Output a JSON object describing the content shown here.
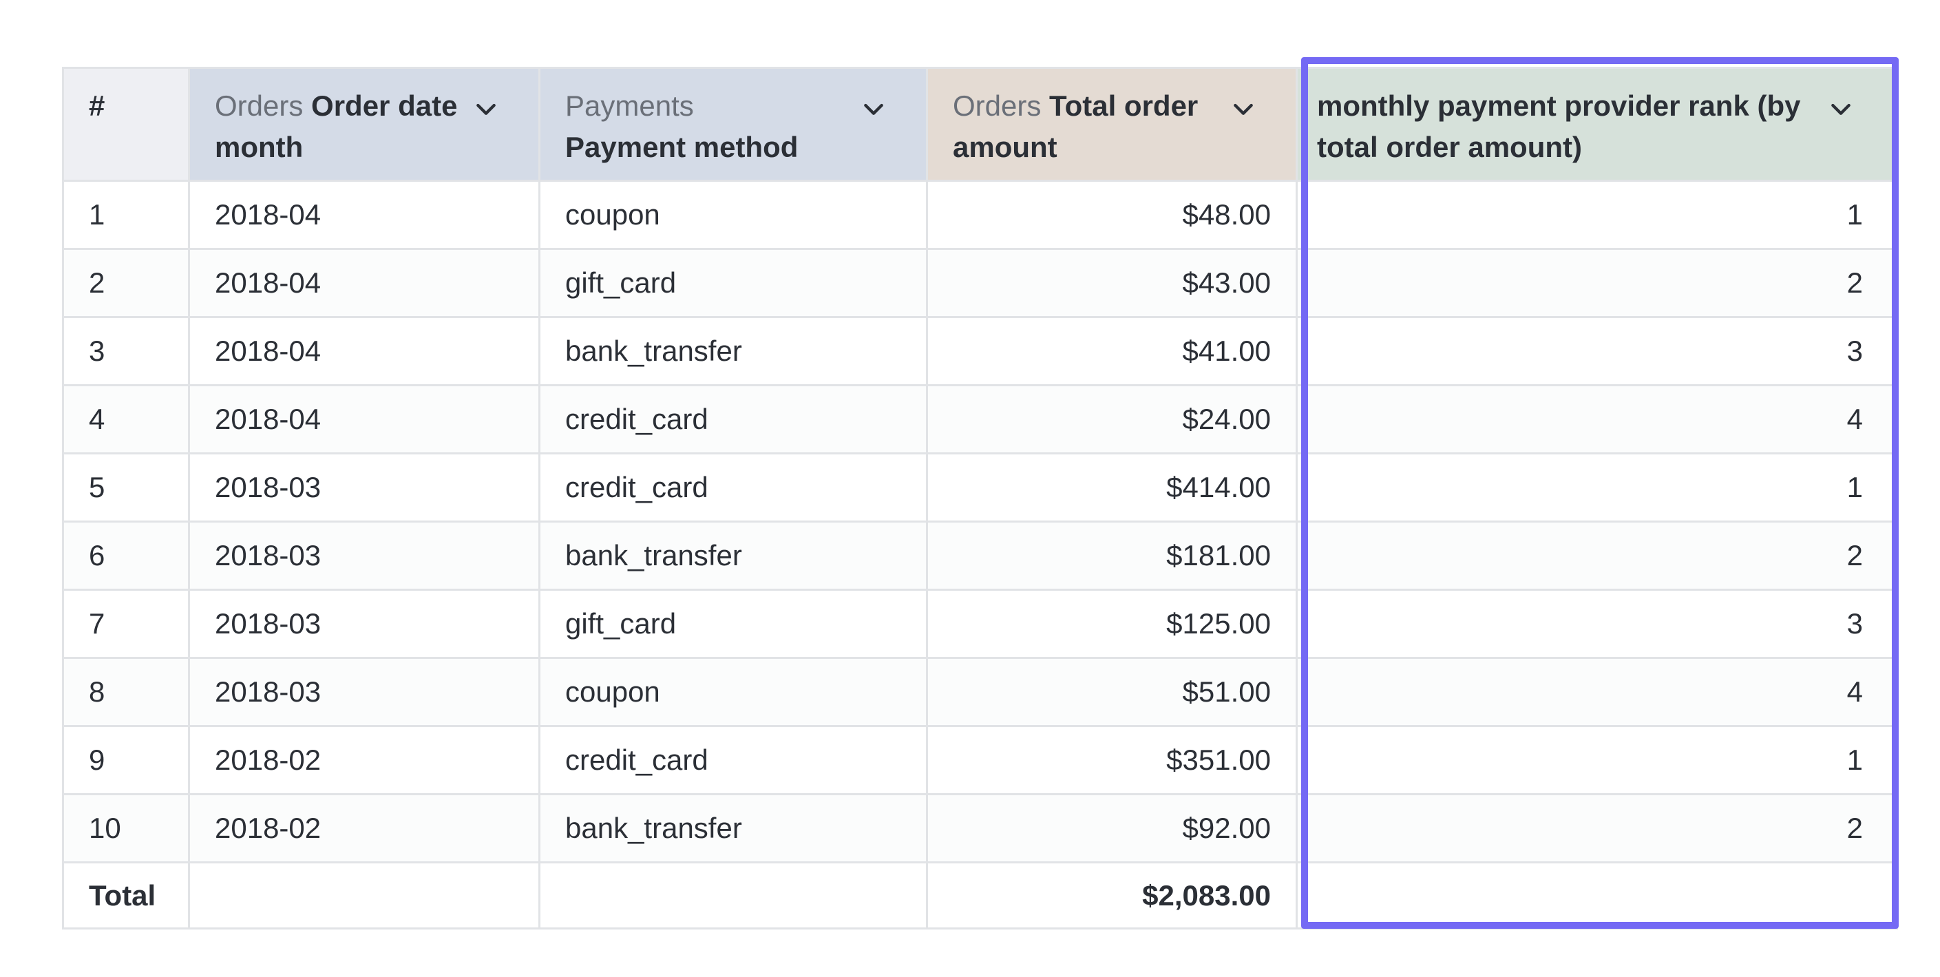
{
  "columns": [
    {
      "prefix": "",
      "main": "#",
      "has_menu": false
    },
    {
      "prefix": "Orders",
      "main": "Order date month",
      "has_menu": true
    },
    {
      "prefix": "Payments",
      "main": "Payment method",
      "has_menu": true
    },
    {
      "prefix": "Orders",
      "main": "Total order amount",
      "has_menu": true
    },
    {
      "prefix": "",
      "main": "monthly payment provider rank (by total order amount)",
      "has_menu": true
    }
  ],
  "rows": [
    {
      "index": "1",
      "month": "2018-04",
      "method": "coupon",
      "amount": "$48.00",
      "rank": "1"
    },
    {
      "index": "2",
      "month": "2018-04",
      "method": "gift_card",
      "amount": "$43.00",
      "rank": "2"
    },
    {
      "index": "3",
      "month": "2018-04",
      "method": "bank_transfer",
      "amount": "$41.00",
      "rank": "3"
    },
    {
      "index": "4",
      "month": "2018-04",
      "method": "credit_card",
      "amount": "$24.00",
      "rank": "4"
    },
    {
      "index": "5",
      "month": "2018-03",
      "method": "credit_card",
      "amount": "$414.00",
      "rank": "1"
    },
    {
      "index": "6",
      "month": "2018-03",
      "method": "bank_transfer",
      "amount": "$181.00",
      "rank": "2"
    },
    {
      "index": "7",
      "month": "2018-03",
      "method": "gift_card",
      "amount": "$125.00",
      "rank": "3"
    },
    {
      "index": "8",
      "month": "2018-03",
      "method": "coupon",
      "amount": "$51.00",
      "rank": "4"
    },
    {
      "index": "9",
      "month": "2018-02",
      "method": "credit_card",
      "amount": "$351.00",
      "rank": "1"
    },
    {
      "index": "10",
      "month": "2018-02",
      "method": "bank_transfer",
      "amount": "$92.00",
      "rank": "2"
    }
  ],
  "totals": {
    "label": "Total",
    "amount": "$2,083.00"
  },
  "icons": {
    "column_menu": "chevron-down-icon"
  },
  "colors": {
    "index_header_bg": "#eeeff3",
    "dimension_header_bg": "#d4dbe7",
    "measure_header_bg": "#e4dbd3",
    "custom_header_bg": "#d6e1da",
    "highlight_border": "#7469f4"
  }
}
